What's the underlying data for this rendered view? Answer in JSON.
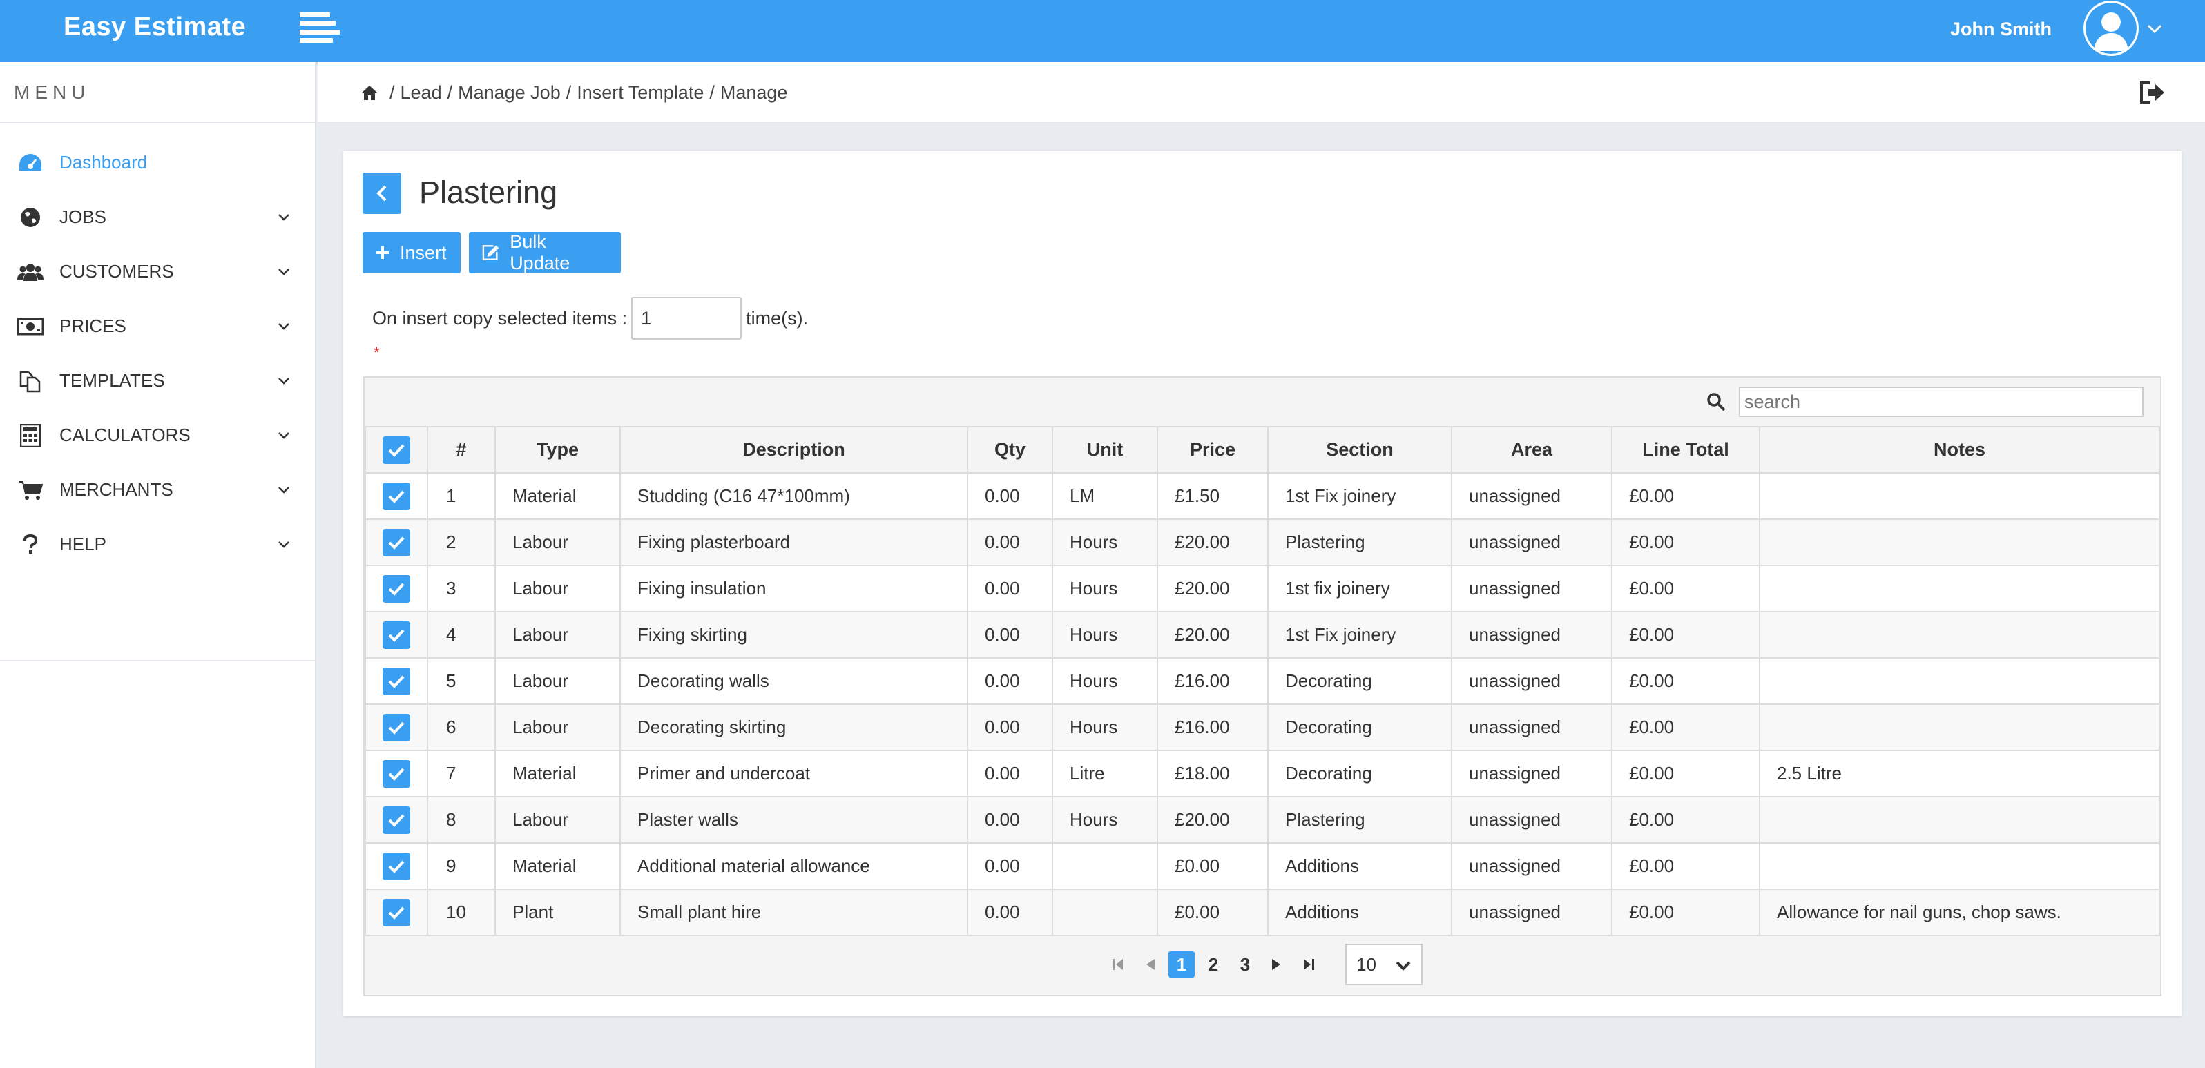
{
  "app": {
    "brand": "Easy Estimate",
    "user_name": "John Smith",
    "accent_color": "#3a9ff0"
  },
  "sidebar": {
    "title": "MENU",
    "items": [
      {
        "label": "Dashboard",
        "icon": "dashboard-icon",
        "active": true
      },
      {
        "label": "JOBS",
        "icon": "globe-icon"
      },
      {
        "label": "CUSTOMERS",
        "icon": "users-icon"
      },
      {
        "label": "PRICES",
        "icon": "money-icon"
      },
      {
        "label": "TEMPLATES",
        "icon": "copy-icon"
      },
      {
        "label": "CALCULATORS",
        "icon": "calculator-icon"
      },
      {
        "label": "MERCHANTS",
        "icon": "cart-icon"
      },
      {
        "label": "HELP",
        "icon": "question-icon"
      }
    ]
  },
  "breadcrumb": {
    "items": [
      "Lead",
      "Manage Job",
      "Insert Template",
      "Manage"
    ],
    "sep": "/"
  },
  "panel": {
    "title": "Plastering",
    "insert_label": "Insert",
    "bulk_update_label": "Bulk Update",
    "copy_label": "On insert copy selected items :",
    "copy_value": "1",
    "copy_suffix": "time(s).",
    "required_marker": "*"
  },
  "table": {
    "search_placeholder": "search",
    "columns": [
      "#",
      "Type",
      "Description",
      "Qty",
      "Unit",
      "Price",
      "Section",
      "Area",
      "Line Total",
      "Notes"
    ],
    "rows": [
      {
        "num": "1",
        "type": "Material",
        "description": "Studding (C16 47*100mm)",
        "qty": "0.00",
        "unit": "LM",
        "price": "£1.50",
        "section": "1st Fix joinery",
        "area": "unassigned",
        "line_total": "£0.00",
        "notes": ""
      },
      {
        "num": "2",
        "type": "Labour",
        "description": "Fixing plasterboard",
        "qty": "0.00",
        "unit": "Hours",
        "price": "£20.00",
        "section": "Plastering",
        "area": "unassigned",
        "line_total": "£0.00",
        "notes": ""
      },
      {
        "num": "3",
        "type": "Labour",
        "description": "Fixing insulation",
        "qty": "0.00",
        "unit": "Hours",
        "price": "£20.00",
        "section": "1st fix joinery",
        "area": "unassigned",
        "line_total": "£0.00",
        "notes": ""
      },
      {
        "num": "4",
        "type": "Labour",
        "description": "Fixing skirting",
        "qty": "0.00",
        "unit": "Hours",
        "price": "£20.00",
        "section": "1st Fix joinery",
        "area": "unassigned",
        "line_total": "£0.00",
        "notes": ""
      },
      {
        "num": "5",
        "type": "Labour",
        "description": "Decorating walls",
        "qty": "0.00",
        "unit": "Hours",
        "price": "£16.00",
        "section": "Decorating",
        "area": "unassigned",
        "line_total": "£0.00",
        "notes": ""
      },
      {
        "num": "6",
        "type": "Labour",
        "description": "Decorating skirting",
        "qty": "0.00",
        "unit": "Hours",
        "price": "£16.00",
        "section": "Decorating",
        "area": "unassigned",
        "line_total": "£0.00",
        "notes": ""
      },
      {
        "num": "7",
        "type": "Material",
        "description": "Primer and undercoat",
        "qty": "0.00",
        "unit": "Litre",
        "price": "£18.00",
        "section": "Decorating",
        "area": "unassigned",
        "line_total": "£0.00",
        "notes": "2.5 Litre"
      },
      {
        "num": "8",
        "type": "Labour",
        "description": "Plaster walls",
        "qty": "0.00",
        "unit": "Hours",
        "price": "£20.00",
        "section": "Plastering",
        "area": "unassigned",
        "line_total": "£0.00",
        "notes": ""
      },
      {
        "num": "9",
        "type": "Material",
        "description": "Additional material allowance",
        "qty": "0.00",
        "unit": "",
        "price": "£0.00",
        "section": "Additions",
        "area": "unassigned",
        "line_total": "£0.00",
        "notes": ""
      },
      {
        "num": "10",
        "type": "Plant",
        "description": "Small plant hire",
        "qty": "0.00",
        "unit": "",
        "price": "£0.00",
        "section": "Additions",
        "area": "unassigned",
        "line_total": "£0.00",
        "notes": "Allowance for nail guns, chop saws."
      }
    ]
  },
  "pagination": {
    "pages": [
      "1",
      "2",
      "3"
    ],
    "current_page": "1",
    "page_size": "10"
  }
}
